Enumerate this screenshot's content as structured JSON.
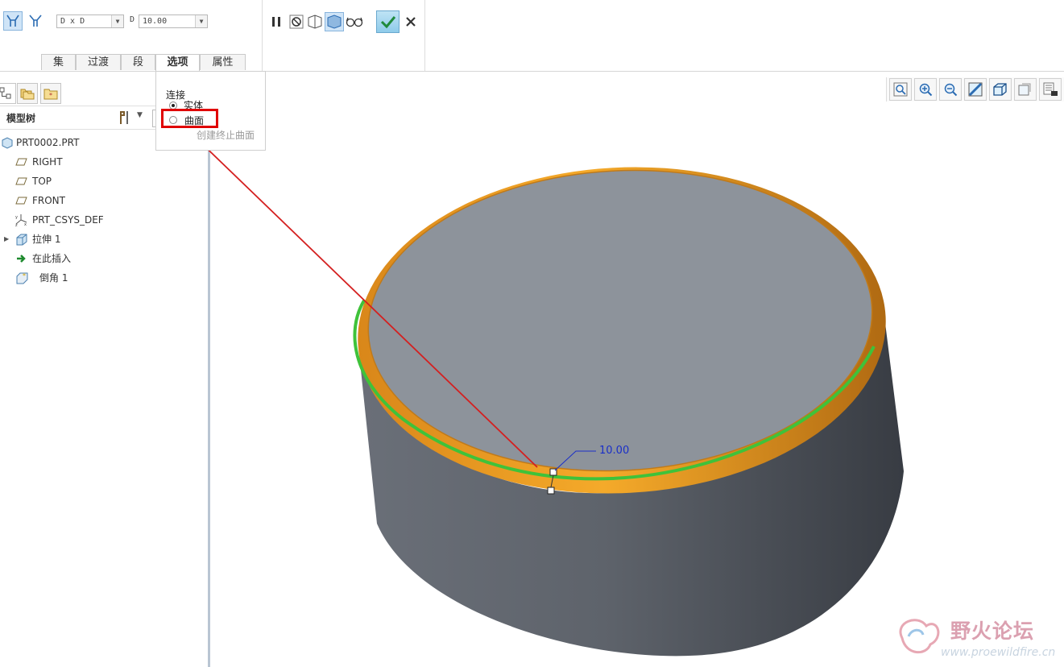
{
  "dashboard": {
    "dimension_scheme": "D x D",
    "d_label": "D",
    "d_value": "10.00",
    "tabs": [
      {
        "label": "集"
      },
      {
        "label": "过渡"
      },
      {
        "label": "段"
      },
      {
        "label": "选项"
      },
      {
        "label": "属性"
      }
    ],
    "selected_tab": "选项"
  },
  "options_panel": {
    "group_label": "连接",
    "radio_solid": "实体",
    "radio_surface": "曲面",
    "checkbox_label": "创建终止曲面",
    "selected": "实体"
  },
  "navigator": {
    "model_tree_label": "模型树",
    "items": [
      {
        "label": "PRT0002.PRT",
        "icon": "part-icon"
      },
      {
        "label": "RIGHT",
        "icon": "datum-plane-icon"
      },
      {
        "label": "TOP",
        "icon": "datum-plane-icon"
      },
      {
        "label": "FRONT",
        "icon": "datum-plane-icon"
      },
      {
        "label": "PRT_CSYS_DEF",
        "icon": "csys-icon"
      },
      {
        "label": "拉伸 1",
        "icon": "extrude-icon"
      },
      {
        "label": "在此插入",
        "icon": "insert-here-icon"
      },
      {
        "label": "倒角 1",
        "icon": "chamfer-icon"
      }
    ]
  },
  "viewport": {
    "dimension_text": "10.00"
  },
  "watermark": {
    "title": "野火论坛",
    "url": "www.proewildfire.cn"
  },
  "colors": {
    "highlight_box": "#e00000",
    "arrow": "#d42020",
    "edge_green": "#3fc23a",
    "chamfer_orange": "#f0a21e",
    "dimension_blue": "#1a2fc8"
  }
}
